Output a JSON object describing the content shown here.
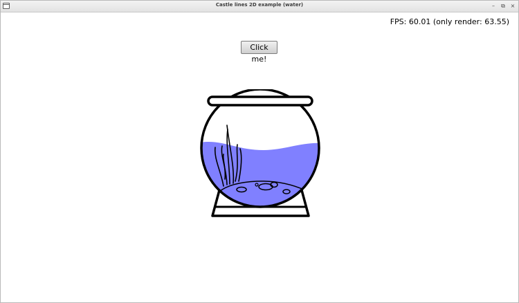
{
  "window": {
    "title": "Castle lines 2D example (water)",
    "controls": {
      "minimize": "–",
      "restore": "⧉",
      "close": "×"
    }
  },
  "fps": {
    "text": "FPS: 60.01 (only render: 63.55)"
  },
  "button": {
    "label": "Click me!"
  },
  "fishbowl": {
    "water_color": "#8080ff",
    "outline_color": "#000000",
    "icon": "fishbowl-icon"
  }
}
